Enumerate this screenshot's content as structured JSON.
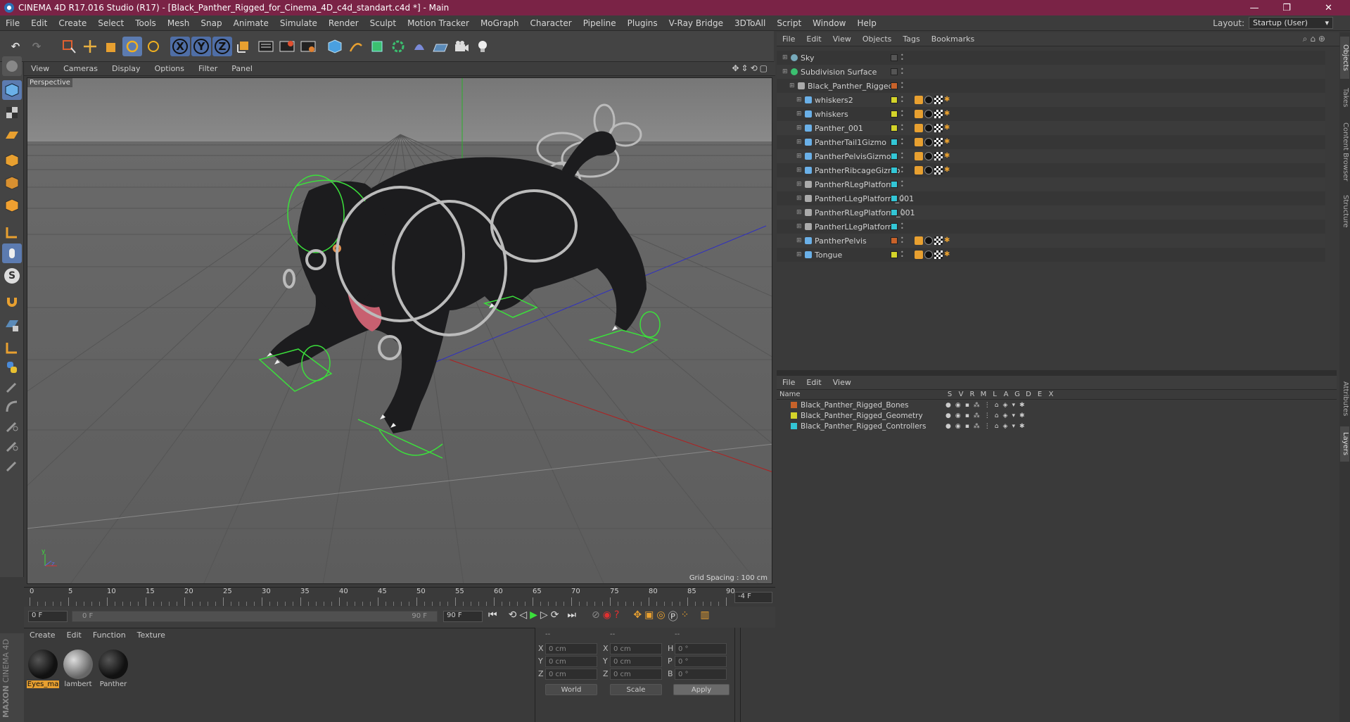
{
  "window": {
    "title": "CINEMA 4D R17.016 Studio (R17) - [Black_Panther_Rigged_for_Cinema_4D_c4d_standart.c4d *] - Main",
    "minimize": "—",
    "maximize": "❐",
    "close": "✕"
  },
  "menubar": {
    "items": [
      "File",
      "Edit",
      "Create",
      "Select",
      "Tools",
      "Mesh",
      "Snap",
      "Animate",
      "Simulate",
      "Render",
      "Sculpt",
      "Motion Tracker",
      "MoGraph",
      "Character",
      "Pipeline",
      "Plugins",
      "V-Ray Bridge",
      "3DToAll",
      "Script",
      "Window",
      "Help"
    ],
    "layout_label": "Layout:",
    "layout_value": "Startup (User)"
  },
  "toolbar": {
    "axis_x": "X",
    "axis_y": "Y",
    "axis_z": "Z"
  },
  "lefttools": {
    "script_label": "S"
  },
  "viewport": {
    "menu": [
      "View",
      "Cameras",
      "Display",
      "Options",
      "Filter",
      "Panel"
    ],
    "label": "Perspective",
    "grid_spacing": "Grid Spacing : 100 cm",
    "axis_y": "y",
    "axis_z": "z"
  },
  "timeline": {
    "ticks": [
      "0",
      "5",
      "10",
      "15",
      "20",
      "25",
      "30",
      "35",
      "40",
      "45",
      "50",
      "55",
      "60",
      "65",
      "70",
      "75",
      "80",
      "85",
      "90"
    ],
    "frame_readout": "-4 F"
  },
  "playbar": {
    "start_frame": "0 F",
    "range_start": "0 F",
    "range_end": "90 F",
    "end_frame": "90 F"
  },
  "materials": {
    "menu": [
      "Create",
      "Edit",
      "Function",
      "Texture"
    ],
    "items": [
      {
        "name": "Eyes_ma",
        "selected": true
      },
      {
        "name": "lambert",
        "selected": false
      },
      {
        "name": "Panther",
        "selected": false
      }
    ],
    "logo_top": "MAXON",
    "logo_bottom": "CINEMA 4D"
  },
  "coordinates": {
    "header": [
      "--",
      "--",
      "--"
    ],
    "rows": [
      {
        "a_label": "X",
        "a_val": "0 cm",
        "b_label": "X",
        "b_val": "0 cm",
        "c_label": "H",
        "c_val": "0 °"
      },
      {
        "a_label": "Y",
        "a_val": "0 cm",
        "b_label": "Y",
        "b_val": "0 cm",
        "c_label": "P",
        "c_val": "0 °"
      },
      {
        "a_label": "Z",
        "a_val": "0 cm",
        "b_label": "Z",
        "b_val": "0 cm",
        "c_label": "B",
        "c_val": "0 °"
      }
    ],
    "space": "World",
    "mode": "Scale",
    "apply": "Apply"
  },
  "objects": {
    "menu": [
      "File",
      "Edit",
      "View",
      "Objects",
      "Tags",
      "Bookmarks"
    ],
    "rows": [
      {
        "name": "Sky",
        "indent": 0,
        "color": "",
        "icon": "sky-icon"
      },
      {
        "name": "Subdivision Surface",
        "indent": 0,
        "color": "",
        "icon": "subdivision-icon"
      },
      {
        "name": "Black_Panther_Rigged",
        "indent": 1,
        "color": "#c8622a",
        "icon": "null-icon"
      },
      {
        "name": "whiskers2",
        "indent": 2,
        "color": "#d4d42a",
        "icon": "bone-icon"
      },
      {
        "name": "whiskers",
        "indent": 2,
        "color": "#d4d42a",
        "icon": "bone-icon"
      },
      {
        "name": "Panther_001",
        "indent": 2,
        "color": "#d4d42a",
        "icon": "bone-icon"
      },
      {
        "name": "PantherTail1Gizmo",
        "indent": 2,
        "color": "#33c6d6",
        "icon": "bone-icon"
      },
      {
        "name": "PantherPelvisGizmo",
        "indent": 2,
        "color": "#33c6d6",
        "icon": "bone-icon"
      },
      {
        "name": "PantherRibcageGizmo",
        "indent": 2,
        "color": "#33c6d6",
        "icon": "bone-icon"
      },
      {
        "name": "PantherRLegPlatform",
        "indent": 2,
        "color": "#33c6d6",
        "icon": "null-icon"
      },
      {
        "name": "PantherLLegPlatform_001",
        "indent": 2,
        "color": "#33c6d6",
        "icon": "null-icon"
      },
      {
        "name": "PantherRLegPlatform_001",
        "indent": 2,
        "color": "#33c6d6",
        "icon": "null-icon"
      },
      {
        "name": "PantherLLegPlatform",
        "indent": 2,
        "color": "#33c6d6",
        "icon": "null-icon"
      },
      {
        "name": "PantherPelvis",
        "indent": 2,
        "color": "#c8622a",
        "icon": "joint-icon"
      },
      {
        "name": "Tongue",
        "indent": 2,
        "color": "#d4d42a",
        "icon": "bone-icon"
      }
    ]
  },
  "layers": {
    "menu": [
      "File",
      "Edit",
      "View"
    ],
    "header_name": "Name",
    "header_cols": [
      "S",
      "V",
      "R",
      "M",
      "L",
      "A",
      "G",
      "D",
      "E",
      "X"
    ],
    "rows": [
      {
        "name": "Black_Panther_Rigged_Bones",
        "color": "#c8622a"
      },
      {
        "name": "Black_Panther_Rigged_Geometry",
        "color": "#d4d42a"
      },
      {
        "name": "Black_Panther_Rigged_Controllers",
        "color": "#33c6d6"
      }
    ]
  },
  "sidetabs": [
    "Objects",
    "Takes",
    "Content Browser",
    "Structure",
    "Attributes",
    "Layers"
  ]
}
